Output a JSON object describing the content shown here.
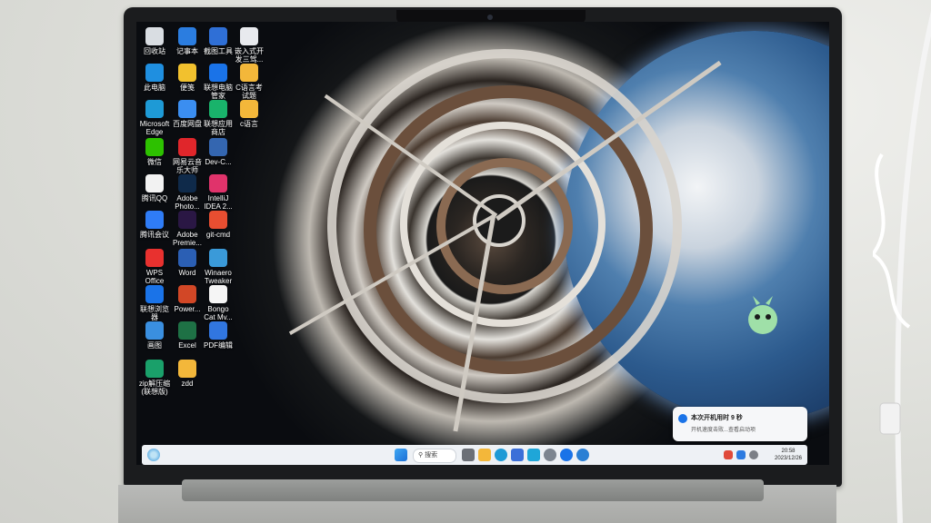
{
  "desktop": {
    "icons": [
      {
        "label": "回收站",
        "icon": "recycle-bin-icon",
        "color": "#d9dde2"
      },
      {
        "label": "记事本",
        "icon": "notepad-icon",
        "color": "#2b7de0"
      },
      {
        "label": "截图工具",
        "icon": "snipping-tool-icon",
        "color": "#2f6fd6"
      },
      {
        "label": "嵌入式开发三驾...",
        "icon": "document-icon",
        "color": "#e8eaee"
      },
      {
        "label": "此电脑",
        "icon": "computer-icon",
        "color": "#1f8fe0"
      },
      {
        "label": "便笺",
        "icon": "sticky-notes-icon",
        "color": "#f2c12e"
      },
      {
        "label": "联想电脑管家",
        "icon": "lenovo-manager-icon",
        "color": "#1a73e8"
      },
      {
        "label": "C语言考试题",
        "icon": "folder-icon",
        "color": "#f3b73a"
      },
      {
        "label": "Microsoft Edge",
        "icon": "edge-icon",
        "color": "#1e9ad6"
      },
      {
        "label": "百度网盘",
        "icon": "baidu-netdisk-icon",
        "color": "#3b8ef0"
      },
      {
        "label": "联想应用商店",
        "icon": "lenovo-store-icon",
        "color": "#19b36b"
      },
      {
        "label": "c语言",
        "icon": "folder-icon",
        "color": "#f3b73a"
      },
      {
        "label": "微信",
        "icon": "wechat-icon",
        "color": "#2dc100"
      },
      {
        "label": "网易云音乐大师",
        "icon": "netease-music-icon",
        "color": "#e0262b"
      },
      {
        "label": "Dev-C...",
        "icon": "dev-cpp-icon",
        "color": "#3466b0"
      },
      {
        "label": "腾讯QQ",
        "icon": "qq-icon",
        "color": "#f2f2f2"
      },
      {
        "label": "Adobe Photo...",
        "icon": "photoshop-icon",
        "color": "#0f2a4a"
      },
      {
        "label": "IntelliJ IDEA 2...",
        "icon": "intellij-icon",
        "color": "#e0336b"
      },
      {
        "label": "腾讯会议",
        "icon": "tencent-meeting-icon",
        "color": "#2f7cf6"
      },
      {
        "label": "Adobe Premie...",
        "icon": "premiere-icon",
        "color": "#2a1744"
      },
      {
        "label": "git-cmd",
        "icon": "git-icon",
        "color": "#e84e31"
      },
      {
        "label": "WPS Office",
        "icon": "wps-icon",
        "color": "#e8312f"
      },
      {
        "label": "Word",
        "icon": "word-icon",
        "color": "#2b5fb4"
      },
      {
        "label": "Winaero Tweaker",
        "icon": "winaero-icon",
        "color": "#3a9ad9"
      },
      {
        "label": "联想浏览器",
        "icon": "lenovo-browser-icon",
        "color": "#1a73e8"
      },
      {
        "label": "Power...",
        "icon": "powerpoint-icon",
        "color": "#d24726"
      },
      {
        "label": "Bongo Cat Mv...",
        "icon": "bongo-cat-icon",
        "color": "#f5f5f5"
      },
      {
        "label": "画图",
        "icon": "paint-icon",
        "color": "#3a8fe0"
      },
      {
        "label": "Excel",
        "icon": "excel-icon",
        "color": "#1e7145"
      },
      {
        "label": "PDF编辑",
        "icon": "pdf-editor-icon",
        "color": "#3176e0"
      },
      {
        "label": "zip解压缩(联想版)",
        "icon": "zip-icon",
        "color": "#1aa06a"
      },
      {
        "label": "zdd",
        "icon": "folder-icon",
        "color": "#f3b73a"
      }
    ]
  },
  "taskbar": {
    "search_placeholder": "搜索",
    "clock_time": "20:58",
    "clock_date": "2023/12/26"
  },
  "notification": {
    "title": "本次开机用时 9 秒",
    "body": "开机速度击败...查看启动项"
  }
}
